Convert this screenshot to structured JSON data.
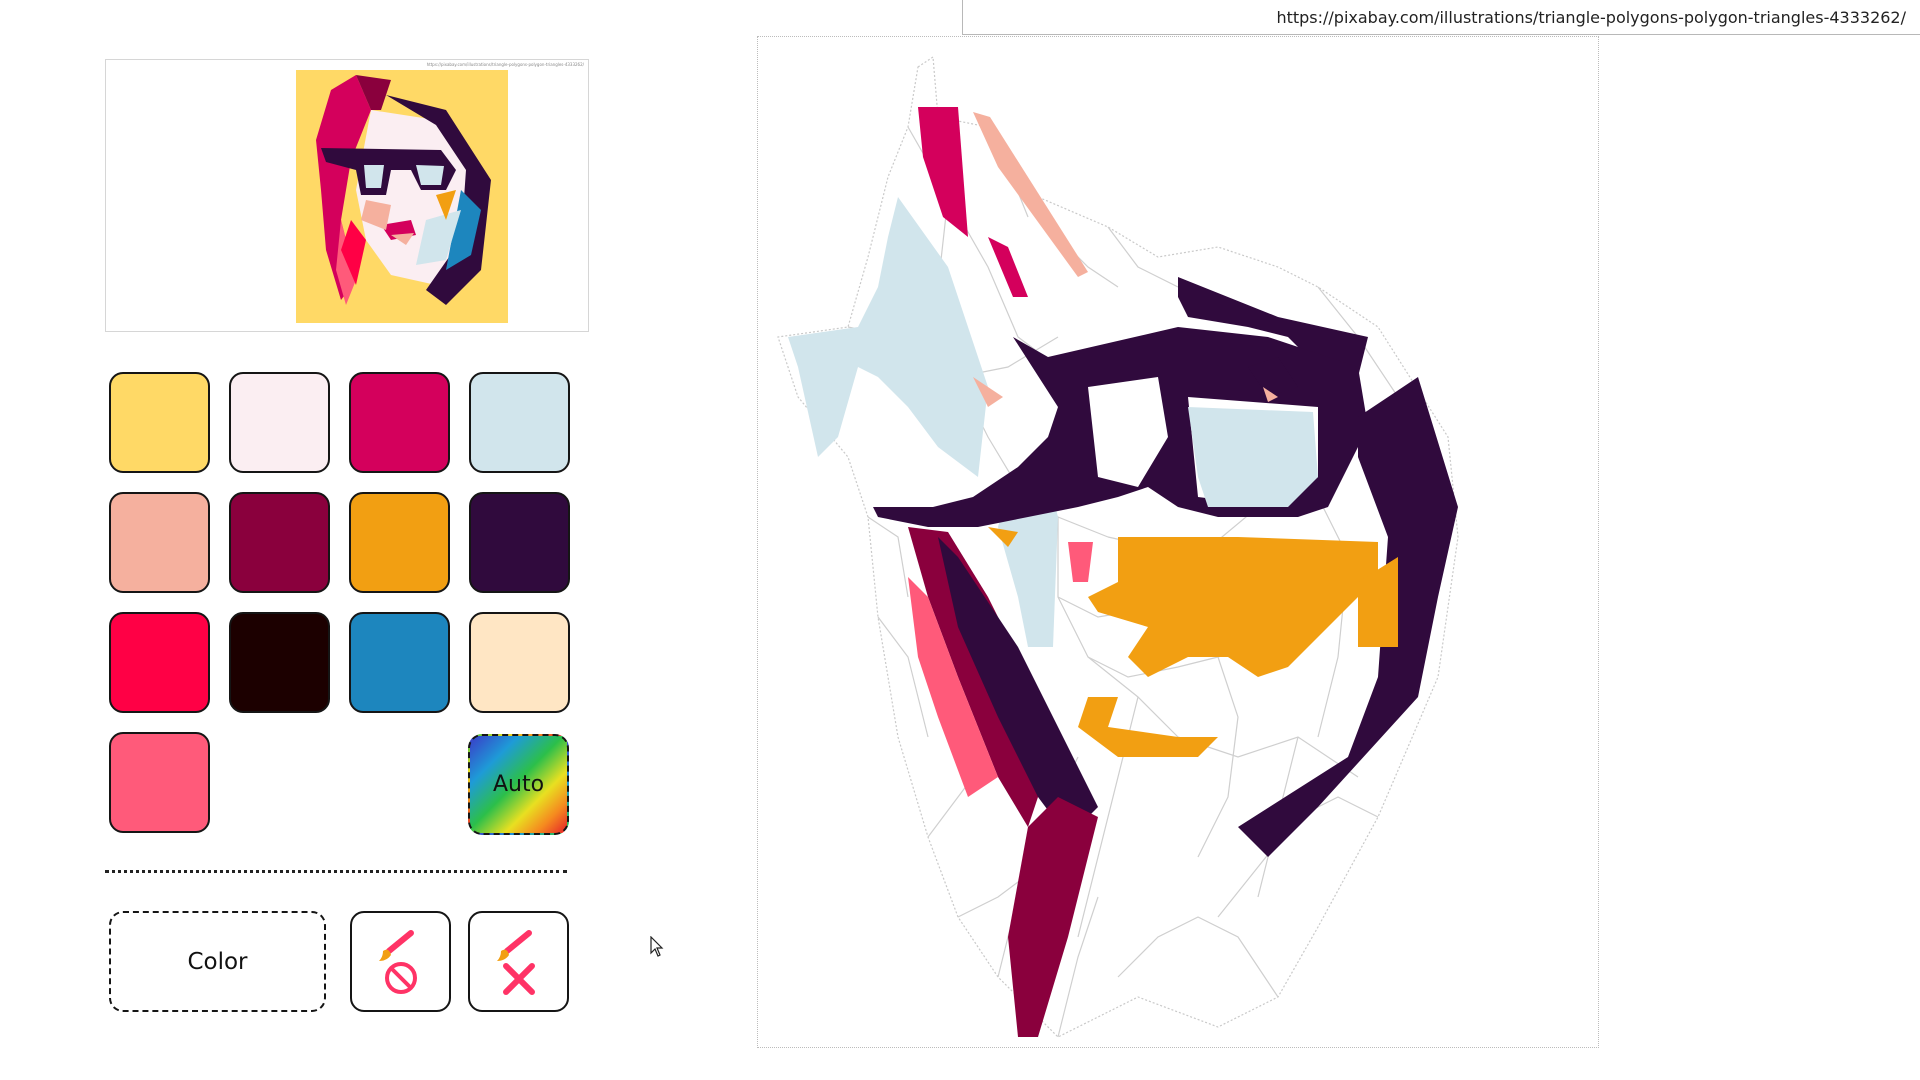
{
  "url_bar": {
    "url": "https://pixabay.com/illustrations/triangle-polygons-polygon-triangles-4333262/"
  },
  "preview": {
    "tiny_url": "https://pixabay.com/illustrations/triangle-polygons-polygon-triangles-4333262/"
  },
  "palette": {
    "swatches": [
      {
        "name": "yellow",
        "color": "#FFD966"
      },
      {
        "name": "pale-pink",
        "color": "#FBEEF2"
      },
      {
        "name": "magenta",
        "color": "#D4005C"
      },
      {
        "name": "light-blue",
        "color": "#D1E5EC"
      },
      {
        "name": "salmon",
        "color": "#F5B09E"
      },
      {
        "name": "crimson",
        "color": "#8A003D"
      },
      {
        "name": "orange",
        "color": "#F29F12"
      },
      {
        "name": "dark-purple",
        "color": "#300A3D"
      },
      {
        "name": "red",
        "color": "#FF0045"
      },
      {
        "name": "near-black",
        "color": "#1C0000"
      },
      {
        "name": "blue",
        "color": "#1D86BE"
      },
      {
        "name": "cream",
        "color": "#FFE6C4"
      },
      {
        "name": "pink",
        "color": "#FF5A7A"
      }
    ],
    "auto_label": "Auto"
  },
  "tools": {
    "color_label": "Color",
    "no_paint_icon": "brush-prohibited-icon",
    "clear_icon": "brush-clear-icon"
  },
  "colors": {
    "outline": "#c9c9c9",
    "accent": "#ff3366"
  }
}
